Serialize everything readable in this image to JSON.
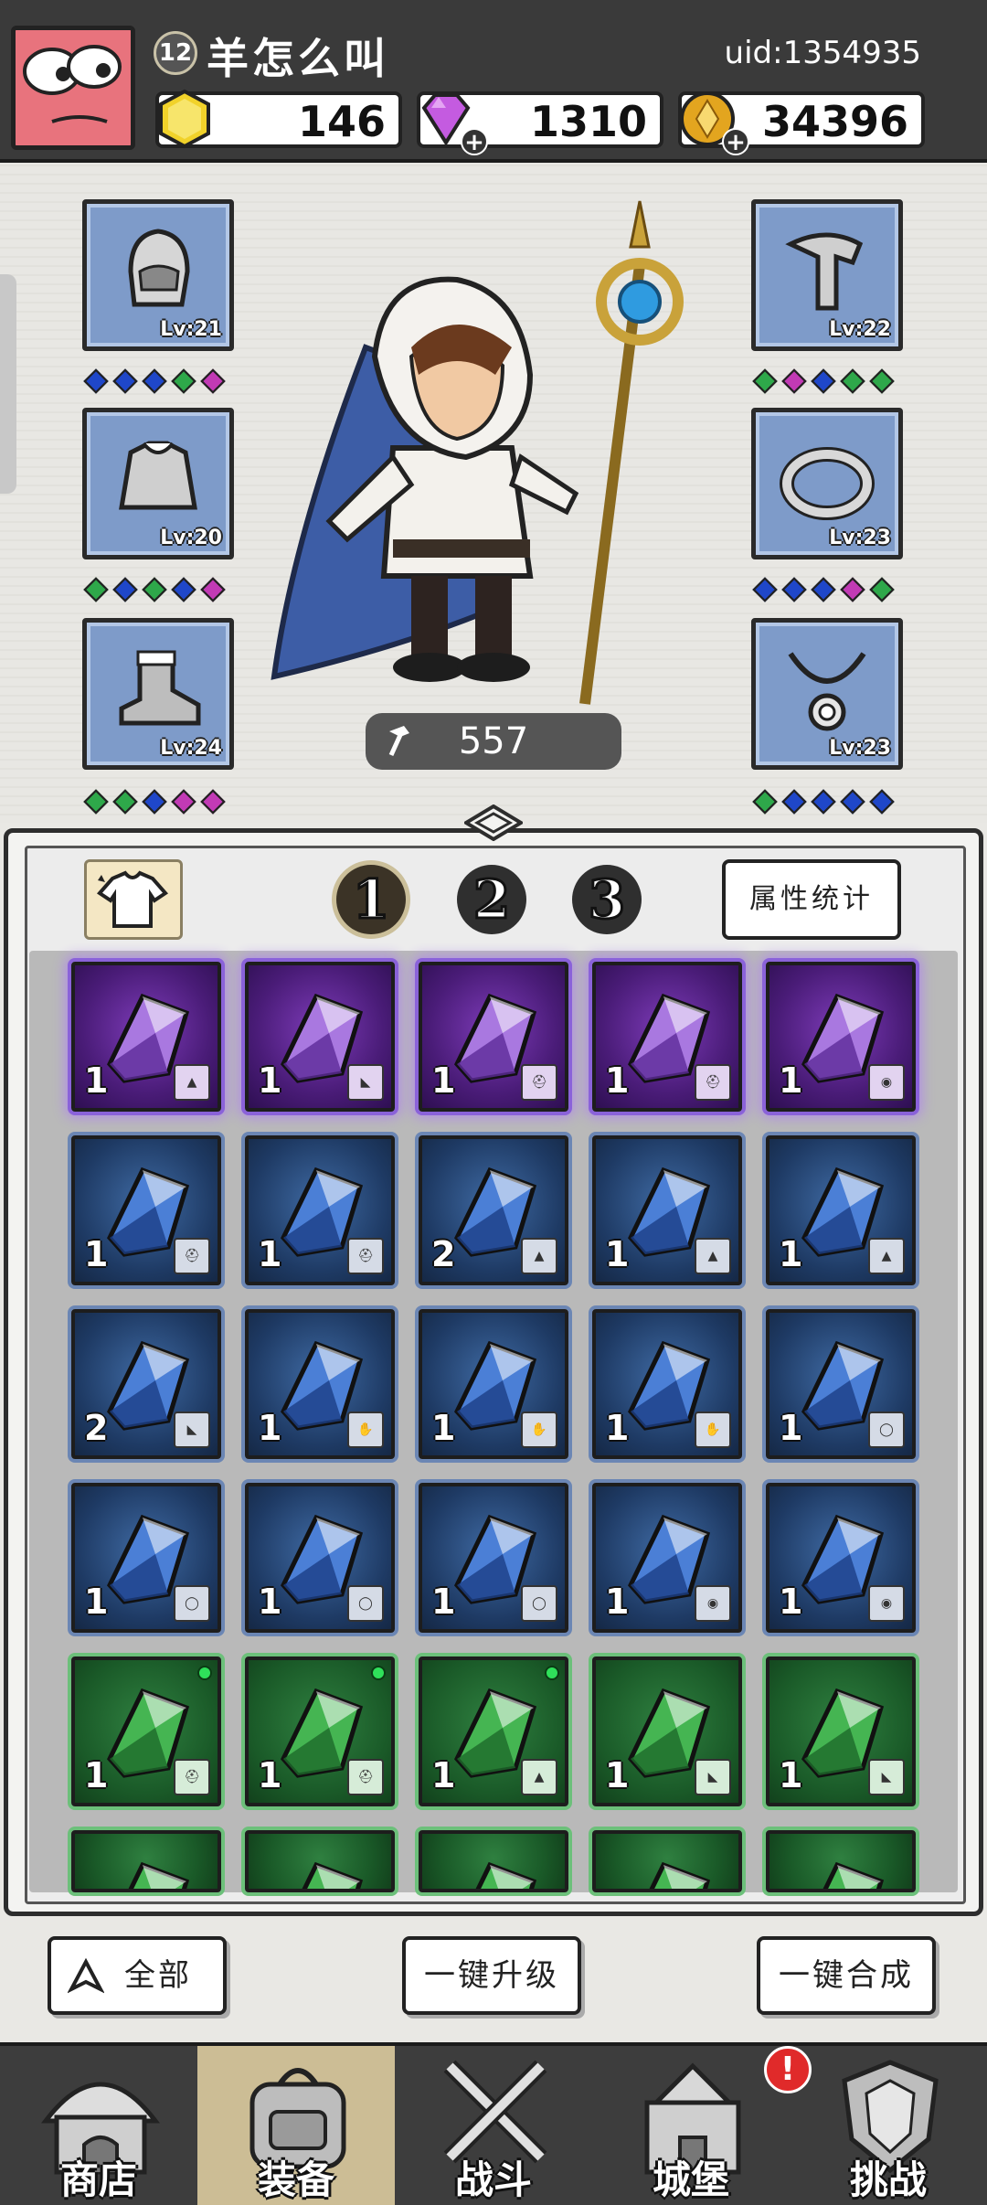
{
  "player": {
    "level": "12",
    "name": "羊怎么叫",
    "uid": "uid:1354935"
  },
  "resources": {
    "gold_gem": "146",
    "diamond": "1310",
    "coin": "34396"
  },
  "hero": {
    "power": "557",
    "left_slots": [
      {
        "name": "helmet",
        "level": "Lv:21",
        "gems": [
          "#1f47c9",
          "#1f47c9",
          "#1f47c9",
          "#2ea84a",
          "#c23ab5"
        ]
      },
      {
        "name": "armor",
        "level": "Lv:20",
        "gems": [
          "#2ea84a",
          "#1f47c9",
          "#2ea84a",
          "#1f47c9",
          "#c23ab5"
        ]
      },
      {
        "name": "boots",
        "level": "Lv:24",
        "gems": [
          "#2ea84a",
          "#2ea84a",
          "#1f47c9",
          "#c23ab5",
          "#c23ab5"
        ]
      }
    ],
    "right_slots": [
      {
        "name": "gloves",
        "level": "Lv:22",
        "gems": [
          "#2ea84a",
          "#c23ab5",
          "#1f47c9",
          "#2ea84a",
          "#2ea84a"
        ]
      },
      {
        "name": "ring",
        "level": "Lv:23",
        "gems": [
          "#1f47c9",
          "#1f47c9",
          "#1f47c9",
          "#c23ab5",
          "#2ea84a"
        ]
      },
      {
        "name": "necklace",
        "level": "Lv:23",
        "gems": [
          "#2ea84a",
          "#1f47c9",
          "#1f47c9",
          "#1f47c9",
          "#1f47c9"
        ]
      }
    ]
  },
  "inventory": {
    "tabs": [
      "1",
      "2",
      "3"
    ],
    "active_tab": "1",
    "stats_button": "属性统计",
    "rows": [
      [
        {
          "rarity": "purple",
          "count": "1",
          "type": "armor"
        },
        {
          "rarity": "purple",
          "count": "1",
          "type": "boots"
        },
        {
          "rarity": "purple",
          "count": "1",
          "type": "helmet"
        },
        {
          "rarity": "purple",
          "count": "1",
          "type": "helmet"
        },
        {
          "rarity": "purple",
          "count": "1",
          "type": "necklace"
        }
      ],
      [
        {
          "rarity": "blue",
          "count": "1",
          "type": "helmet"
        },
        {
          "rarity": "blue",
          "count": "1",
          "type": "helmet"
        },
        {
          "rarity": "blue",
          "count": "2",
          "type": "armor"
        },
        {
          "rarity": "blue",
          "count": "1",
          "type": "armor"
        },
        {
          "rarity": "blue",
          "count": "1",
          "type": "armor"
        }
      ],
      [
        {
          "rarity": "blue",
          "count": "2",
          "type": "boots"
        },
        {
          "rarity": "blue",
          "count": "1",
          "type": "gloves"
        },
        {
          "rarity": "blue",
          "count": "1",
          "type": "gloves"
        },
        {
          "rarity": "blue",
          "count": "1",
          "type": "gloves"
        },
        {
          "rarity": "blue",
          "count": "1",
          "type": "ring"
        }
      ],
      [
        {
          "rarity": "blue",
          "count": "1",
          "type": "ring"
        },
        {
          "rarity": "blue",
          "count": "1",
          "type": "ring"
        },
        {
          "rarity": "blue",
          "count": "1",
          "type": "ring"
        },
        {
          "rarity": "blue",
          "count": "1",
          "type": "necklace"
        },
        {
          "rarity": "blue",
          "count": "1",
          "type": "necklace"
        }
      ],
      [
        {
          "rarity": "green",
          "count": "1",
          "type": "helmet",
          "new": true
        },
        {
          "rarity": "green",
          "count": "1",
          "type": "helmet",
          "new": true
        },
        {
          "rarity": "green",
          "count": "1",
          "type": "armor",
          "new": true
        },
        {
          "rarity": "green",
          "count": "1",
          "type": "boots"
        },
        {
          "rarity": "green",
          "count": "1",
          "type": "boots"
        }
      ],
      [
        {
          "rarity": "green",
          "count": "",
          "type": ""
        },
        {
          "rarity": "green",
          "count": "",
          "type": ""
        },
        {
          "rarity": "green",
          "count": "",
          "type": ""
        },
        {
          "rarity": "green",
          "count": "",
          "type": ""
        },
        {
          "rarity": "green",
          "count": "",
          "type": ""
        }
      ]
    ]
  },
  "actions": {
    "filter_all": "全部",
    "upgrade_all": "一键升级",
    "merge_all": "一键合成"
  },
  "nav": [
    {
      "label": "商店",
      "icon": "shop-icon",
      "active": false
    },
    {
      "label": "装备",
      "icon": "backpack-icon",
      "active": true
    },
    {
      "label": "战斗",
      "icon": "swords-icon",
      "active": false
    },
    {
      "label": "城堡",
      "icon": "castle-icon",
      "active": false
    },
    {
      "label": "挑战",
      "icon": "shield-icon",
      "active": false
    }
  ],
  "alert_badge": "!",
  "colors": {
    "purple_rarity": "#8a62d9",
    "blue_rarity": "#6b86b4",
    "green_rarity": "#6cc07a",
    "active_nav": "#ccbd95"
  }
}
